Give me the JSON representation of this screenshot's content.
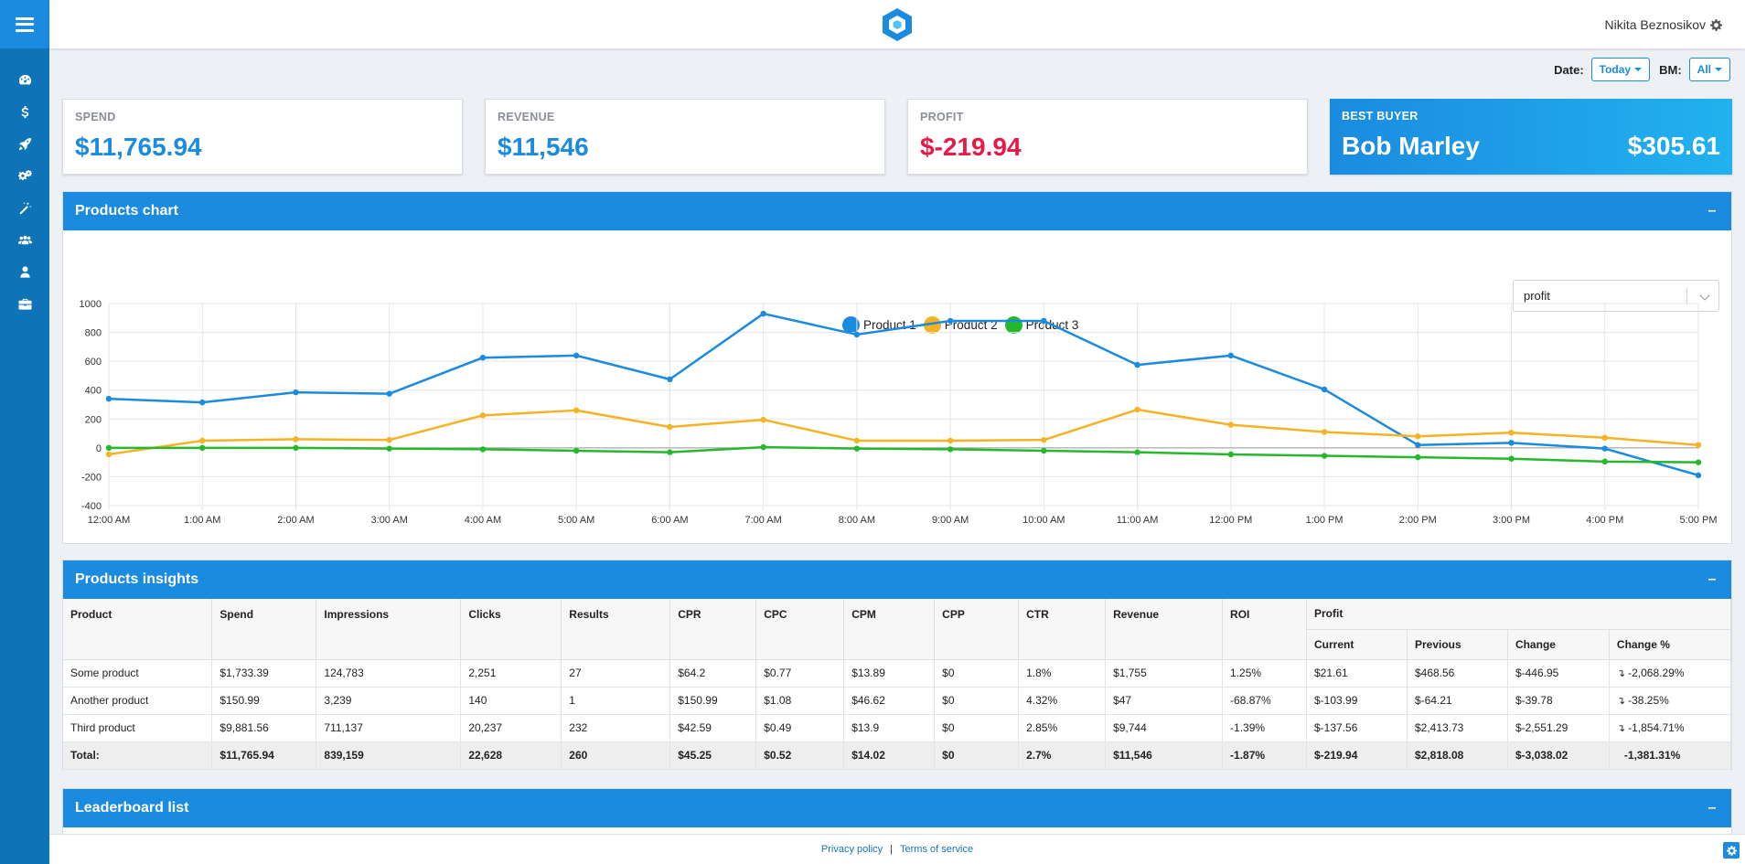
{
  "header": {
    "user_name": "Nikita Beznosikov"
  },
  "filters": {
    "date_label": "Date:",
    "date_value": "Today",
    "bm_label": "BM:",
    "bm_value": "All"
  },
  "kpis": {
    "spend": {
      "label": "SPEND",
      "value": "$11,765.94"
    },
    "revenue": {
      "label": "REVENUE",
      "value": "$11,546"
    },
    "profit": {
      "label": "PROFIT",
      "value": "$-219.94"
    },
    "best_buyer": {
      "label": "BEST BUYER",
      "name": "Bob Marley",
      "value": "$305.61"
    }
  },
  "products_chart": {
    "title": "Products chart",
    "collapse": "–",
    "metric_select": "profit"
  },
  "chart_data": {
    "type": "line",
    "x": [
      "12:00 AM",
      "1:00 AM",
      "2:00 AM",
      "3:00 AM",
      "4:00 AM",
      "5:00 AM",
      "6:00 AM",
      "7:00 AM",
      "8:00 AM",
      "9:00 AM",
      "10:00 AM",
      "11:00 AM",
      "12:00 PM",
      "1:00 PM",
      "2:00 PM",
      "3:00 PM",
      "4:00 PM",
      "5:00 PM"
    ],
    "series": [
      {
        "name": "Product 1",
        "color": "#1b8be0",
        "values": [
          340,
          315,
          385,
          375,
          625,
          640,
          475,
          930,
          785,
          880,
          880,
          575,
          640,
          405,
          20,
          35,
          -5,
          -190
        ]
      },
      {
        "name": "Product 2",
        "color": "#f5b324",
        "values": [
          -45,
          50,
          60,
          55,
          225,
          260,
          145,
          195,
          50,
          50,
          55,
          265,
          160,
          110,
          80,
          105,
          70,
          20
        ]
      },
      {
        "name": "Product 3",
        "color": "#24b82a",
        "values": [
          0,
          0,
          0,
          -5,
          -10,
          -20,
          -30,
          5,
          -5,
          -10,
          -20,
          -30,
          -45,
          -55,
          -65,
          -75,
          -95,
          -100
        ]
      }
    ],
    "ylim": [
      -400,
      1000
    ],
    "yticks": [
      1000,
      800,
      600,
      400,
      200,
      0,
      -200,
      -400
    ],
    "grid": true,
    "legend": "top-center"
  },
  "insights": {
    "title": "Products insights",
    "collapse": "–",
    "columns": [
      "Product",
      "Spend",
      "Impressions",
      "Clicks",
      "Results",
      "CPR",
      "CPC",
      "CPM",
      "CPP",
      "CTR",
      "Revenue",
      "ROI",
      "Profit"
    ],
    "profit_sub": [
      "Current",
      "Previous",
      "Change",
      "Change %"
    ],
    "rows": [
      {
        "product": "Some product",
        "spend": "$1,733.39",
        "impressions": "124,783",
        "clicks": "2,251",
        "results": "27",
        "cpr": "$64.2",
        "cpc": "$0.77",
        "cpm": "$13.89",
        "cpp": "$0",
        "ctr": "1.8%",
        "revenue": "$1,755",
        "roi": "1.25%",
        "current": "$21.61",
        "previous": "$468.56",
        "change": "$-446.95",
        "change_pct": "-2,068.29%"
      },
      {
        "product": "Another product",
        "spend": "$150.99",
        "impressions": "3,239",
        "clicks": "140",
        "results": "1",
        "cpr": "$150.99",
        "cpc": "$1.08",
        "cpm": "$46.62",
        "cpp": "$0",
        "ctr": "4.32%",
        "revenue": "$47",
        "roi": "-68.87%",
        "current": "$-103.99",
        "previous": "$-64.21",
        "change": "$-39.78",
        "change_pct": "-38.25%"
      },
      {
        "product": "Third product",
        "spend": "$9,881.56",
        "impressions": "711,137",
        "clicks": "20,237",
        "results": "232",
        "cpr": "$42.59",
        "cpc": "$0.49",
        "cpm": "$13.9",
        "cpp": "$0",
        "ctr": "2.85%",
        "revenue": "$9,744",
        "roi": "-1.39%",
        "current": "$-137.56",
        "previous": "$2,413.73",
        "change": "$-2,551.29",
        "change_pct": "-1,854.71%"
      }
    ],
    "total": {
      "label": "Total:",
      "spend": "$11,765.94",
      "impressions": "839,159",
      "clicks": "22,628",
      "results": "260",
      "cpr": "$45.25",
      "cpc": "$0.52",
      "cpm": "$14.02",
      "cpp": "$0",
      "ctr": "2.7%",
      "revenue": "$11,546",
      "roi": "-1.87%",
      "current": "$-219.94",
      "previous": "$2,818.08",
      "change": "$-3,038.02",
      "change_pct": "-1,381.31%"
    }
  },
  "leaderboard": {
    "title": "Leaderboard list",
    "collapse": "–"
  },
  "footer": {
    "privacy": "Privacy policy",
    "separator": "|",
    "terms": "Terms of service"
  },
  "colors": {
    "brand": "#1b8be0",
    "negative": "#ea1845",
    "positive": "#24a514",
    "warning": "#f5b324"
  }
}
